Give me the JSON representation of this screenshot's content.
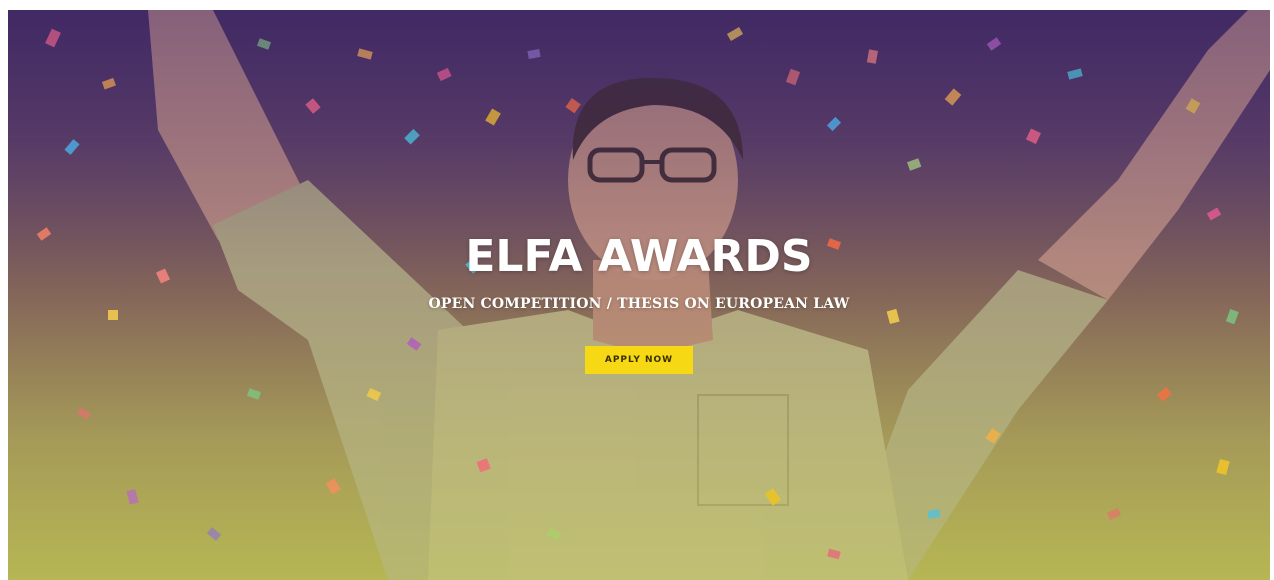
{
  "hero": {
    "title": "ELFA AWARDS",
    "subtitle": "OPEN COMPETITION / THESIS ON EUROPEAN LAW",
    "cta_label": "APPLY NOW",
    "background_image": "person-celebrating-with-confetti",
    "colors": {
      "overlay_top": "#3d2a5c",
      "overlay_bottom": "#b7b35e",
      "button": "#f6d814",
      "title_text": "#ffffff"
    }
  }
}
